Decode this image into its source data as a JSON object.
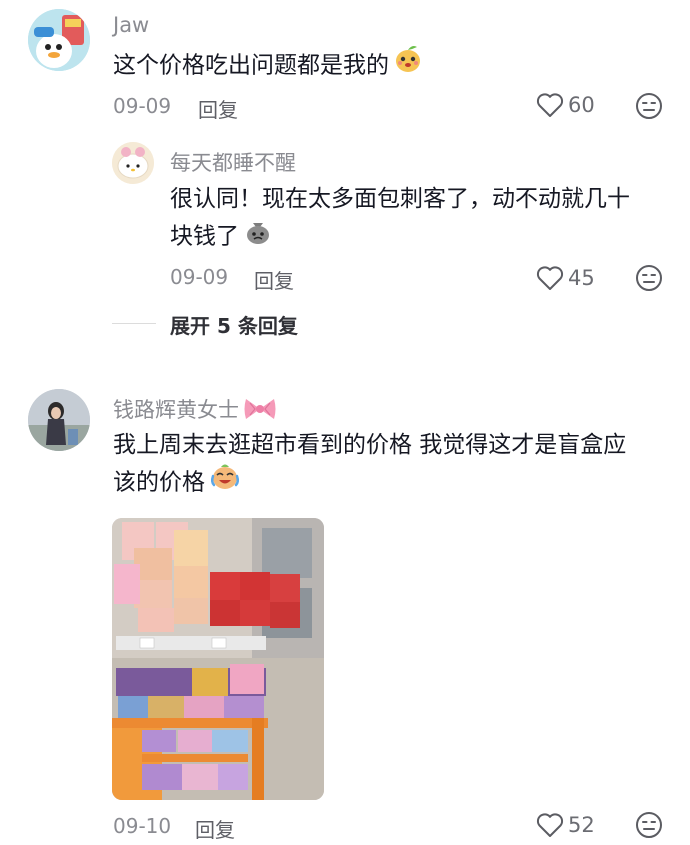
{
  "comments": [
    {
      "username": "Jaw",
      "text": "这个价格吃出问题都是我的",
      "emoji": "pear-face-emoji",
      "date": "09-09",
      "reply_label": "回复",
      "likes": "60",
      "replies": [
        {
          "username": "每天都睡不醒",
          "text_line1": "很认同！现在太多面包刺客了，动不动就几十",
          "text_line2": "块钱了",
          "emoji": "money-bag-emoji",
          "date": "09-09",
          "reply_label": "回复",
          "likes": "45"
        }
      ],
      "expand_label": "展开 5 条回复"
    },
    {
      "username": "钱路辉黄女士",
      "username_badge": "pink-bow-emoji",
      "text_line1": "我上周末去逛超市看到的价格 我觉得这才是盲盒应",
      "text_line2": "该的价格",
      "emoji": "crying-laughing-emoji",
      "date": "09-10",
      "reply_label": "回复",
      "likes": "52",
      "has_image": true
    }
  ],
  "colors": {
    "text_primary": "#161823",
    "text_secondary": "#8a8b91",
    "divider": "#dcdcdc"
  }
}
